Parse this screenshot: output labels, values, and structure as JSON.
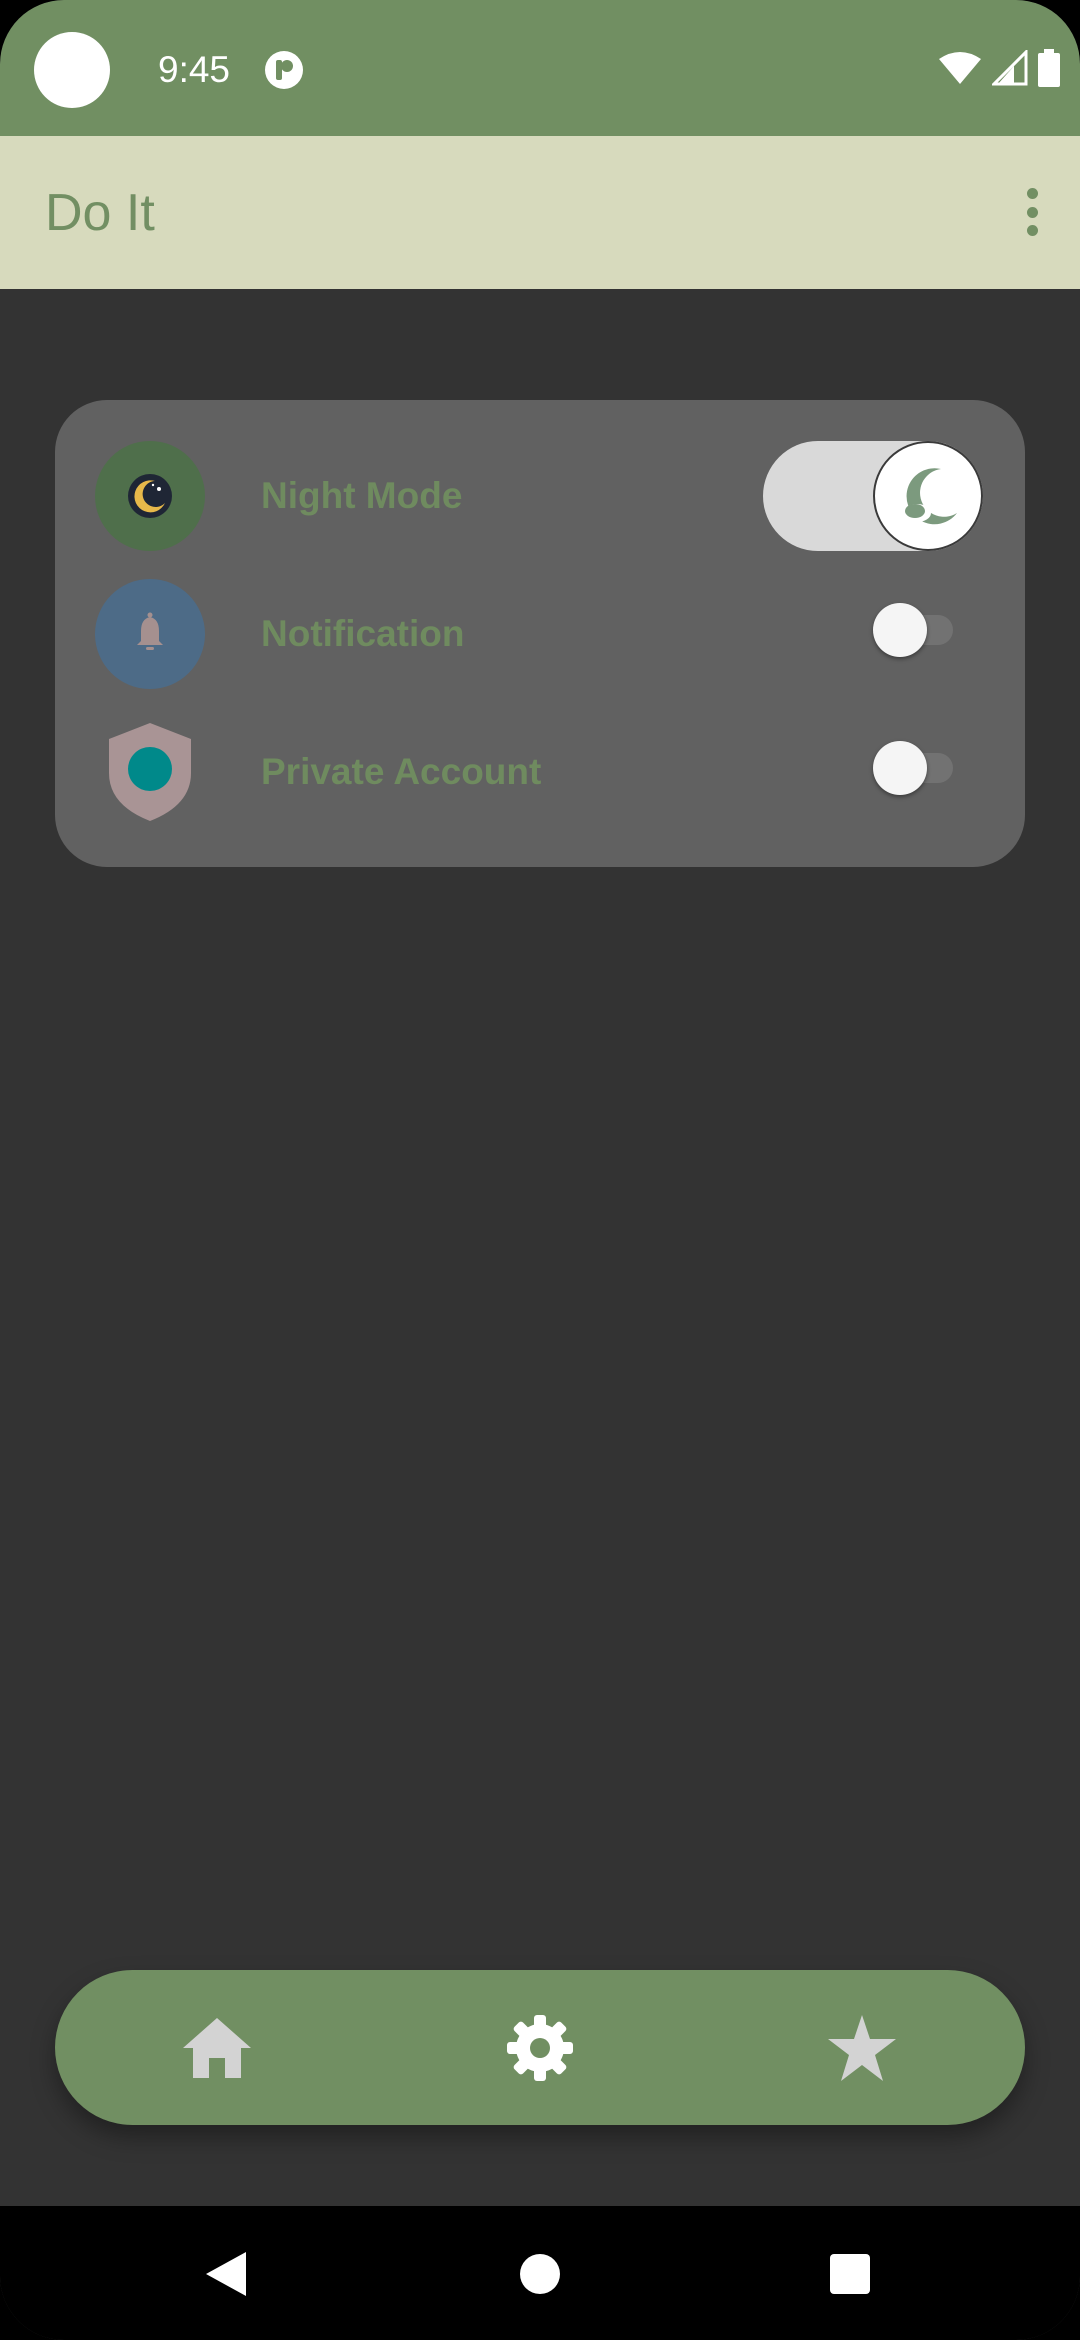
{
  "status_bar": {
    "time": "9:45",
    "icons": [
      "camera-cutout",
      "app-notification-icon",
      "wifi-icon",
      "cellular-signal-icon",
      "battery-icon"
    ]
  },
  "app_bar": {
    "title": "Do It",
    "menu_icon": "more-vertical-icon"
  },
  "settings": {
    "items": [
      {
        "label": "Night Mode",
        "icon": "moon-icon",
        "enabled": true
      },
      {
        "label": "Notification",
        "icon": "bell-icon",
        "enabled": false
      },
      {
        "label": "Private Account",
        "icon": "shield-icon",
        "enabled": false
      }
    ]
  },
  "bottom_nav": {
    "items": [
      {
        "icon": "home-icon"
      },
      {
        "icon": "gear-icon"
      },
      {
        "icon": "star-icon"
      }
    ]
  },
  "system_nav": {
    "items": [
      {
        "icon": "back-icon"
      },
      {
        "icon": "home-circle-icon"
      },
      {
        "icon": "recents-icon"
      }
    ]
  },
  "colors": {
    "primary": "#718f62",
    "app_bar_bg": "#d7dabd",
    "background": "#333333",
    "card": "#616161",
    "label": "#6f8b5f",
    "notification_icon_bg": "#4d6b87",
    "night_icon_bg": "#4f6f4b",
    "shield": "#a99495",
    "shield_dot": "#00898a"
  }
}
